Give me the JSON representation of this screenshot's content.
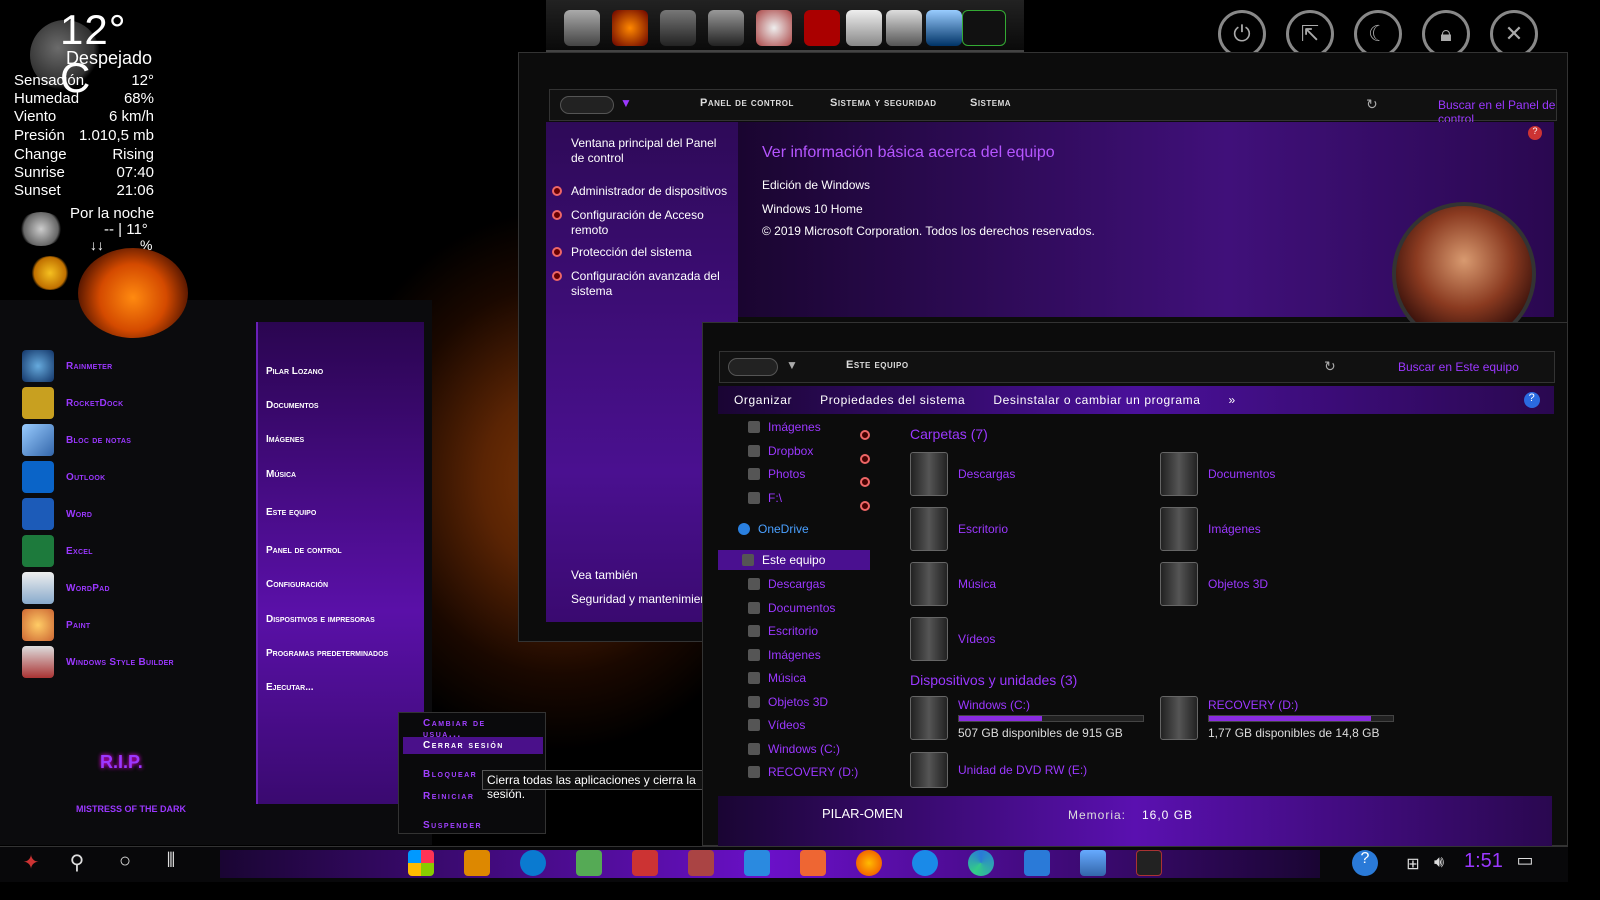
{
  "weather": {
    "temp": "12° C",
    "condition": "Despejado",
    "rows": [
      {
        "label": "Sensación",
        "value": "12°"
      },
      {
        "label": "Humedad",
        "value": "68%"
      },
      {
        "label": "Viento",
        "value": "6 km/h"
      },
      {
        "label": "Presión",
        "value": "1.010,5 mb"
      },
      {
        "label": "Change",
        "value": "Rising"
      },
      {
        "label": "Sunrise",
        "value": "07:40"
      },
      {
        "label": "Sunset",
        "value": "21:06"
      }
    ],
    "night_label": "Por la noche",
    "night_value": "-- | 11°",
    "arrows": "↓↓",
    "pct": "%"
  },
  "start_menu": {
    "apps": [
      "Rainmeter",
      "RocketDock",
      "Bloc de notas",
      "Outlook",
      "Word",
      "Excel",
      "WordPad",
      "Paint",
      "Windows Style Builder"
    ],
    "places": [
      "Pilar Lozano",
      "Documentos",
      "Imágenes",
      "Música",
      "Este equipo",
      "Panel de control",
      "Configuración",
      "Dispositivos e impresoras",
      "Programas predeterminados",
      "Ejecutar..."
    ],
    "power_menu": [
      "Cambiar de usua...",
      "Cerrar sesión",
      "Bloquear",
      "Reiniciar",
      "Suspender"
    ],
    "tooltip": "Cierra todas las aplicaciones y cierra la sesión.",
    "brand": "R.I.P.",
    "brand_sub": "MISTRESS OF THE DARK"
  },
  "top_right_icons": [
    "power-icon",
    "logoff-icon",
    "sleep-icon",
    "lock-icon",
    "close-icon"
  ],
  "control_panel": {
    "breadcrumb": [
      "Panel de control",
      "Sistema y seguridad",
      "Sistema"
    ],
    "search_placeholder": "Buscar en el Panel de control",
    "left_links": {
      "home": "Ventana principal del Panel de control",
      "items": [
        "Administrador de dispositivos",
        "Configuración de Acceso remoto",
        "Protección del sistema",
        "Configuración avanzada del sistema"
      ],
      "see_also": "Vea también",
      "security": "Seguridad y mantenimier"
    },
    "heading": "Ver información básica acerca del equipo",
    "edition_label": "Edición de Windows",
    "edition": "Windows 10 Home",
    "copyright": "© 2019 Microsoft Corporation. Todos los derechos reservados."
  },
  "explorer": {
    "breadcrumb": "Este equipo",
    "search_placeholder": "Buscar en Este equipo",
    "commands": [
      "Organizar",
      "Propiedades del sistema",
      "Desinstalar o cambiar un programa",
      "»"
    ],
    "nav_quick": [
      "Imágenes",
      "Dropbox",
      "Photos",
      "F:\\"
    ],
    "nav_onedrive": "OneDrive",
    "nav_this_pc": "Este equipo",
    "nav_pc_children": [
      "Descargas",
      "Documentos",
      "Escritorio",
      "Imágenes",
      "Música",
      "Objetos 3D",
      "Vídeos",
      "Windows (C:)",
      "RECOVERY (D:)"
    ],
    "folders_header": "Carpetas (7)",
    "folders": [
      "Descargas",
      "Documentos",
      "Escritorio",
      "Imágenes",
      "Música",
      "Objetos 3D",
      "Vídeos"
    ],
    "devices_header": "Dispositivos y unidades (3)",
    "drives": [
      {
        "name": "Windows (C:)",
        "free": "507 GB disponibles de 915 GB",
        "used_fraction": 0.45
      },
      {
        "name": "RECOVERY (D:)",
        "free": "1,77 GB disponibles de 14,8 GB",
        "used_fraction": 0.88
      }
    ],
    "dvd": "Unidad de DVD RW (E:)",
    "details_name": "PILAR-OMEN",
    "details_mem_label": "Memoria:",
    "details_mem": "16,0 GB"
  },
  "taskbar": {
    "clock": "1:51"
  },
  "colors": {
    "accent": "#9b38ff",
    "panel_purple": "#4a1090"
  }
}
